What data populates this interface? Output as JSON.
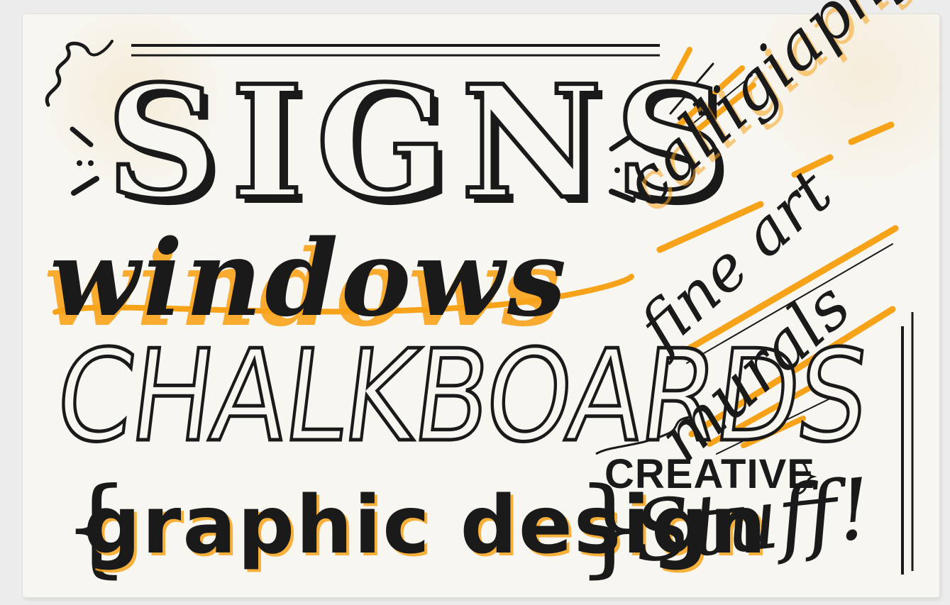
{
  "card": {
    "signs": "SIGNS",
    "windows": "windows",
    "chalkboards": "CHALKBOARDS",
    "brace_left": "{",
    "graphic_design": "graphic design",
    "brace_right": "}",
    "calligraphy": "calligiaphy",
    "fine_art": "fine art",
    "murals": "murals",
    "creative": "CREATIVE",
    "stuff": "Stuff!"
  },
  "colors": {
    "paper": "#f7f6f1",
    "ink": "#1a1a1a",
    "accent": "#f7a31a"
  }
}
